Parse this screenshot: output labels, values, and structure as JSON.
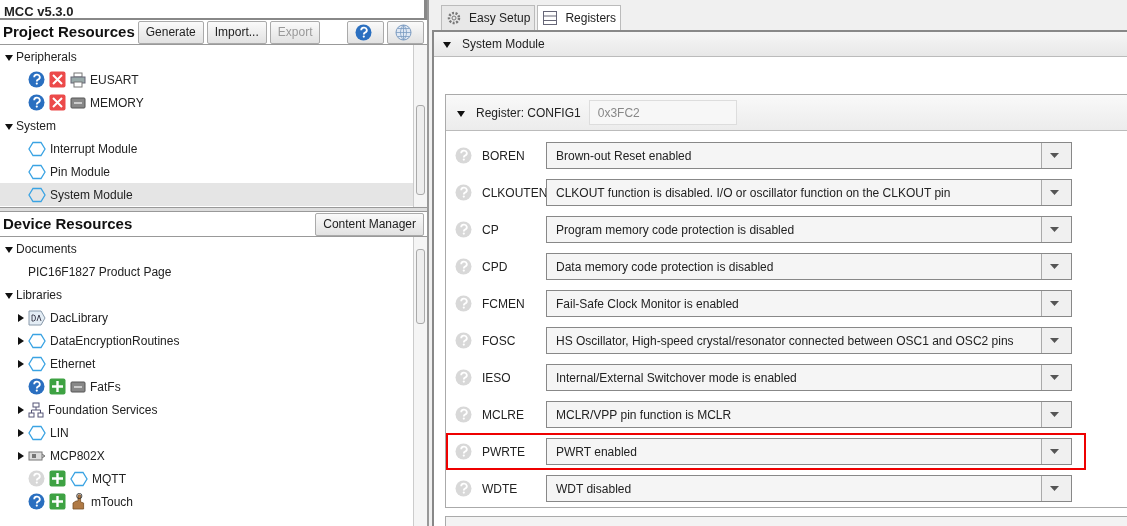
{
  "window": {
    "title": "MCC v5.3.0"
  },
  "project_resources": {
    "title": "Project Resources",
    "buttons": [
      {
        "label": "Generate",
        "disabled": false
      },
      {
        "label": "Import...",
        "disabled": false
      },
      {
        "label": "Export",
        "disabled": true
      }
    ],
    "tree": [
      {
        "label": "Peripherals",
        "expanded": true,
        "children": [
          {
            "label": "EUSART",
            "kind": "printer",
            "help_disabled": false,
            "removable": true
          },
          {
            "label": "MEMORY",
            "kind": "chip",
            "help_disabled": false,
            "removable": true
          }
        ]
      },
      {
        "label": "System",
        "expanded": true,
        "children": [
          {
            "label": "Interrupt Module",
            "kind": "hexagon",
            "selected": false
          },
          {
            "label": "Pin Module",
            "kind": "hexagon",
            "selected": false
          },
          {
            "label": "System Module",
            "kind": "hexagon",
            "selected": true
          }
        ]
      }
    ]
  },
  "device_resources": {
    "title": "Device Resources",
    "button": "Content Manager",
    "tree": [
      {
        "label": "Documents",
        "expanded": true,
        "children": [
          {
            "label": "PIC16F1827 Product Page",
            "kind": "document"
          }
        ]
      },
      {
        "label": "Libraries",
        "expanded": true,
        "children": [
          {
            "label": "DacLibrary",
            "kind": "dac",
            "expanded": false
          },
          {
            "label": "DataEncryptionRoutines",
            "kind": "hexagon",
            "expanded": false
          },
          {
            "label": "Ethernet",
            "kind": "hexagon",
            "expanded": false
          },
          {
            "label": "FatFs",
            "kind": "chip",
            "help_disabled": false,
            "addable": true
          },
          {
            "label": "Foundation Services",
            "kind": "network",
            "expanded": false
          },
          {
            "label": "LIN",
            "kind": "hexagon",
            "expanded": false
          },
          {
            "label": "MCP802X",
            "kind": "module",
            "expanded": false
          },
          {
            "label": "MQTT",
            "kind": "hexagon",
            "help_disabled": true,
            "addable": true
          },
          {
            "label": "mTouch",
            "kind": "touch",
            "help_disabled": false,
            "addable": true
          }
        ]
      }
    ]
  },
  "tabs": [
    {
      "label": "Easy Setup",
      "kind": "gear",
      "selected": false
    },
    {
      "label": "Registers",
      "kind": "registers",
      "selected": true
    }
  ],
  "section": {
    "title": "System Module",
    "expanded": true
  },
  "register": {
    "label": "Register: CONFIG1",
    "value": "0x3FC2",
    "expanded": true,
    "rows": [
      {
        "name": "BOREN",
        "value": "Brown-out Reset enabled",
        "highlighted": false
      },
      {
        "name": "CLKOUTEN",
        "value": "CLKOUT function is disabled. I/O or oscillator function on the CLKOUT pin",
        "highlighted": false
      },
      {
        "name": "CP",
        "value": "Program memory code protection is disabled",
        "highlighted": false
      },
      {
        "name": "CPD",
        "value": "Data memory code protection is disabled",
        "highlighted": false
      },
      {
        "name": "FCMEN",
        "value": "Fail-Safe Clock Monitor is enabled",
        "highlighted": false
      },
      {
        "name": "FOSC",
        "value": "HS Oscillator, High-speed crystal/resonator connected between OSC1 and OSC2 pins",
        "highlighted": false
      },
      {
        "name": "IESO",
        "value": "Internal/External Switchover mode is enabled",
        "highlighted": false
      },
      {
        "name": "MCLRE",
        "value": "MCLR/VPP pin function is MCLR",
        "highlighted": false
      },
      {
        "name": "PWRTE",
        "value": "PWRT enabled",
        "highlighted": true
      },
      {
        "name": "WDTE",
        "value": "WDT disabled",
        "highlighted": false
      }
    ]
  }
}
